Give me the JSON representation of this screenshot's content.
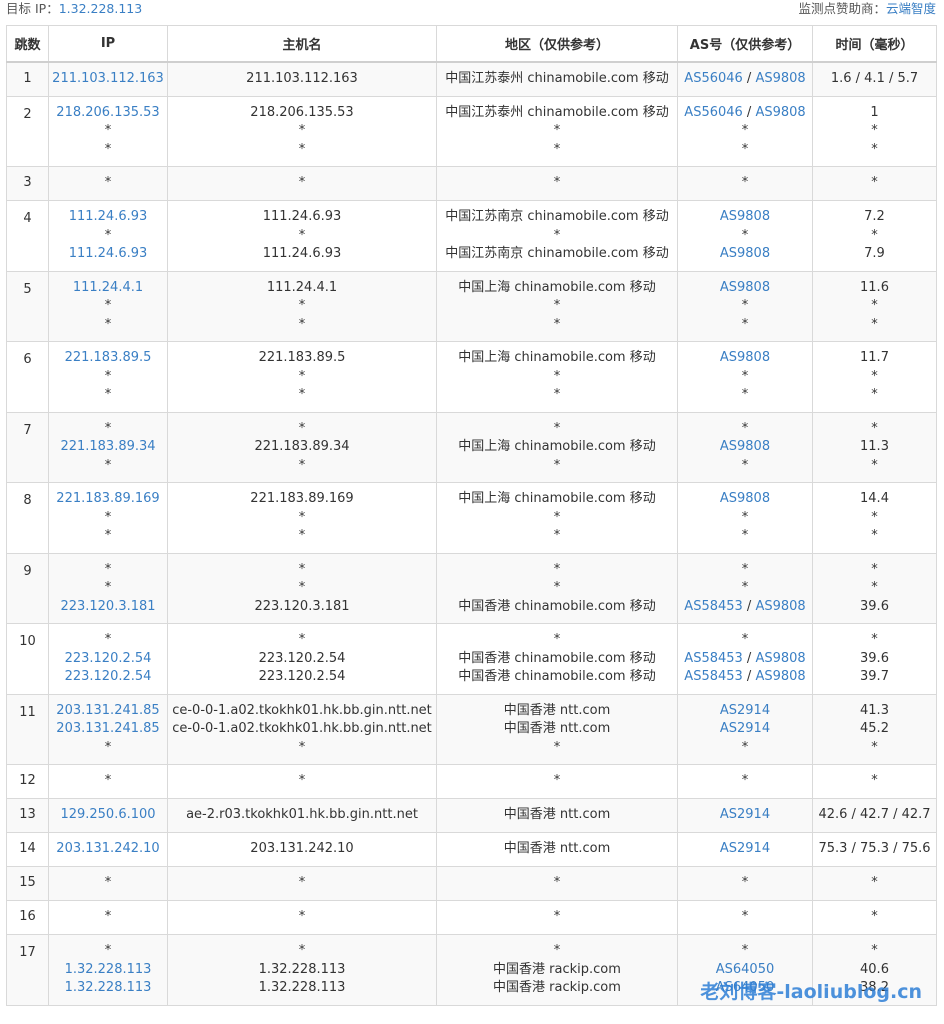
{
  "header": {
    "target_label": "目标 IP：",
    "target_ip": "1.32.228.113",
    "sponsor_label": "监测点赞助商：",
    "sponsor_name": "云端智度"
  },
  "columns": [
    "跳数",
    "IP",
    "主机名",
    "地区（仅供参考）",
    "AS号（仅供参考）",
    "时间（毫秒）"
  ],
  "watermark": "老刘博客-laoliublog.cn",
  "rows": [
    {
      "hop": "1",
      "lines": [
        {
          "ip": "211.103.112.163",
          "host": "211.103.112.163",
          "region": "中国江苏泰州 chinamobile.com 移动",
          "as": [
            "AS56046",
            "AS9808"
          ],
          "time": "1.6 / 4.1 / 5.7"
        }
      ]
    },
    {
      "hop": "2",
      "lines": [
        {
          "ip": "218.206.135.53",
          "host": "218.206.135.53",
          "region": "中国江苏泰州 chinamobile.com 移动",
          "as": [
            "AS56046",
            "AS9808"
          ],
          "time": "1"
        },
        {
          "ip": "*",
          "host": "*",
          "region": "*",
          "as": [
            "*"
          ],
          "time": "*"
        },
        {
          "ip": "*",
          "host": "*",
          "region": "*",
          "as": [
            "*"
          ],
          "time": "*"
        }
      ]
    },
    {
      "hop": "3",
      "lines": [
        {
          "ip": "*",
          "host": "*",
          "region": "*",
          "as": [
            "*"
          ],
          "time": "*"
        }
      ]
    },
    {
      "hop": "4",
      "lines": [
        {
          "ip": "111.24.6.93",
          "host": "111.24.6.93",
          "region": "中国江苏南京 chinamobile.com 移动",
          "as": [
            "AS9808"
          ],
          "time": "7.2"
        },
        {
          "ip": "*",
          "host": "*",
          "region": "*",
          "as": [
            "*"
          ],
          "time": "*"
        },
        {
          "ip": "111.24.6.93",
          "host": "111.24.6.93",
          "region": "中国江苏南京 chinamobile.com 移动",
          "as": [
            "AS9808"
          ],
          "time": "7.9"
        }
      ]
    },
    {
      "hop": "5",
      "lines": [
        {
          "ip": "111.24.4.1",
          "host": "111.24.4.1",
          "region": "中国上海 chinamobile.com 移动",
          "as": [
            "AS9808"
          ],
          "time": "11.6"
        },
        {
          "ip": "*",
          "host": "*",
          "region": "*",
          "as": [
            "*"
          ],
          "time": "*"
        },
        {
          "ip": "*",
          "host": "*",
          "region": "*",
          "as": [
            "*"
          ],
          "time": "*"
        }
      ]
    },
    {
      "hop": "6",
      "lines": [
        {
          "ip": "221.183.89.5",
          "host": "221.183.89.5",
          "region": "中国上海 chinamobile.com 移动",
          "as": [
            "AS9808"
          ],
          "time": "11.7"
        },
        {
          "ip": "*",
          "host": "*",
          "region": "*",
          "as": [
            "*"
          ],
          "time": "*"
        },
        {
          "ip": "*",
          "host": "*",
          "region": "*",
          "as": [
            "*"
          ],
          "time": "*"
        }
      ]
    },
    {
      "hop": "7",
      "lines": [
        {
          "ip": "*",
          "host": "*",
          "region": "*",
          "as": [
            "*"
          ],
          "time": "*"
        },
        {
          "ip": "221.183.89.34",
          "host": "221.183.89.34",
          "region": "中国上海 chinamobile.com 移动",
          "as": [
            "AS9808"
          ],
          "time": "11.3"
        },
        {
          "ip": "*",
          "host": "*",
          "region": "*",
          "as": [
            "*"
          ],
          "time": "*"
        }
      ]
    },
    {
      "hop": "8",
      "lines": [
        {
          "ip": "221.183.89.169",
          "host": "221.183.89.169",
          "region": "中国上海 chinamobile.com 移动",
          "as": [
            "AS9808"
          ],
          "time": "14.4"
        },
        {
          "ip": "*",
          "host": "*",
          "region": "*",
          "as": [
            "*"
          ],
          "time": "*"
        },
        {
          "ip": "*",
          "host": "*",
          "region": "*",
          "as": [
            "*"
          ],
          "time": "*"
        }
      ]
    },
    {
      "hop": "9",
      "lines": [
        {
          "ip": "*",
          "host": "*",
          "region": "*",
          "as": [
            "*"
          ],
          "time": "*"
        },
        {
          "ip": "*",
          "host": "*",
          "region": "*",
          "as": [
            "*"
          ],
          "time": "*"
        },
        {
          "ip": "223.120.3.181",
          "host": "223.120.3.181",
          "region": "中国香港 chinamobile.com 移动",
          "as": [
            "AS58453",
            "AS9808"
          ],
          "time": "39.6"
        }
      ]
    },
    {
      "hop": "10",
      "lines": [
        {
          "ip": "*",
          "host": "*",
          "region": "*",
          "as": [
            "*"
          ],
          "time": "*"
        },
        {
          "ip": "223.120.2.54",
          "host": "223.120.2.54",
          "region": "中国香港 chinamobile.com 移动",
          "as": [
            "AS58453",
            "AS9808"
          ],
          "time": "39.6"
        },
        {
          "ip": "223.120.2.54",
          "host": "223.120.2.54",
          "region": "中国香港 chinamobile.com 移动",
          "as": [
            "AS58453",
            "AS9808"
          ],
          "time": "39.7"
        }
      ]
    },
    {
      "hop": "11",
      "lines": [
        {
          "ip": "203.131.241.85",
          "host": "ce-0-0-1.a02.tkokhk01.hk.bb.gin.ntt.net",
          "region": "中国香港 ntt.com",
          "as": [
            "AS2914"
          ],
          "time": "41.3"
        },
        {
          "ip": "203.131.241.85",
          "host": "ce-0-0-1.a02.tkokhk01.hk.bb.gin.ntt.net",
          "region": "中国香港 ntt.com",
          "as": [
            "AS2914"
          ],
          "time": "45.2"
        },
        {
          "ip": "*",
          "host": "*",
          "region": "*",
          "as": [
            "*"
          ],
          "time": "*"
        }
      ]
    },
    {
      "hop": "12",
      "lines": [
        {
          "ip": "*",
          "host": "*",
          "region": "*",
          "as": [
            "*"
          ],
          "time": "*"
        }
      ]
    },
    {
      "hop": "13",
      "lines": [
        {
          "ip": "129.250.6.100",
          "host": "ae-2.r03.tkokhk01.hk.bb.gin.ntt.net",
          "region": "中国香港 ntt.com",
          "as": [
            "AS2914"
          ],
          "time": "42.6 / 42.7 / 42.7"
        }
      ]
    },
    {
      "hop": "14",
      "lines": [
        {
          "ip": "203.131.242.10",
          "host": "203.131.242.10",
          "region": "中国香港 ntt.com",
          "as": [
            "AS2914"
          ],
          "time": "75.3 / 75.3 / 75.6"
        }
      ]
    },
    {
      "hop": "15",
      "lines": [
        {
          "ip": "*",
          "host": "*",
          "region": "*",
          "as": [
            "*"
          ],
          "time": "*"
        }
      ]
    },
    {
      "hop": "16",
      "lines": [
        {
          "ip": "*",
          "host": "*",
          "region": "*",
          "as": [
            "*"
          ],
          "time": "*"
        }
      ]
    },
    {
      "hop": "17",
      "lines": [
        {
          "ip": "*",
          "host": "*",
          "region": "*",
          "as": [
            "*"
          ],
          "time": "*"
        },
        {
          "ip": "1.32.228.113",
          "host": "1.32.228.113",
          "region": "中国香港 rackip.com",
          "as": [
            "AS64050"
          ],
          "time": "40.6"
        },
        {
          "ip": "1.32.228.113",
          "host": "1.32.228.113",
          "region": "中国香港 rackip.com",
          "as": [
            "AS64050"
          ],
          "time": "38.2"
        }
      ]
    }
  ]
}
